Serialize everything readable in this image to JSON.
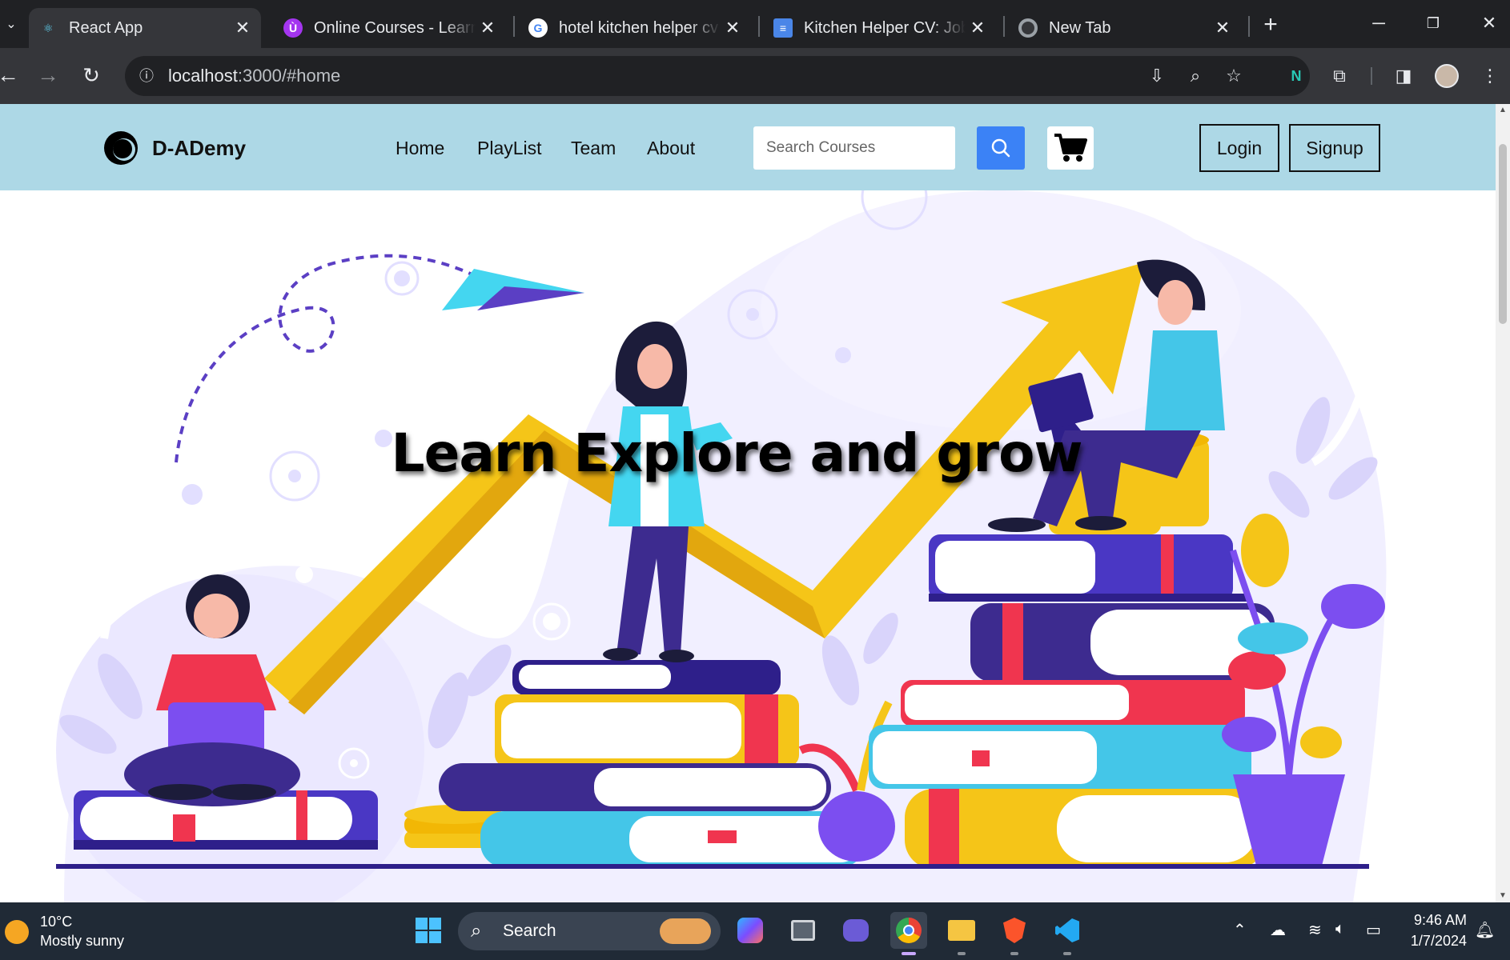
{
  "browser": {
    "tabs": [
      {
        "title": "React App",
        "icon": "react-icon",
        "active": true
      },
      {
        "title": "Online Courses - Learn Anything",
        "icon": "udemy-icon",
        "active": false
      },
      {
        "title": "hotel kitchen helper cv sample",
        "icon": "google-icon",
        "active": false
      },
      {
        "title": "Kitchen Helper CV: Job Description",
        "icon": "docs-icon",
        "active": false
      },
      {
        "title": "New Tab",
        "icon": "chrome-icon",
        "active": false
      }
    ],
    "url_host": "localhost",
    "url_path": ":3000/#home"
  },
  "site": {
    "brand": "D-ADemy",
    "nav": {
      "home": "Home",
      "playlist": "PlayList",
      "team": "Team",
      "about": "About"
    },
    "search_placeholder": "Search Courses",
    "login": "Login",
    "signup": "Signup",
    "hero_heading": "Learn Explore and grow"
  },
  "taskbar": {
    "weather_temp": "10°C",
    "weather_desc": "Mostly sunny",
    "search_label": "Search",
    "time": "9:46 AM",
    "date": "1/7/2024"
  },
  "colors": {
    "navbar_bg": "#add8e6",
    "search_button": "#3b82f6",
    "arrow_yellow": "#f5c518",
    "book_purple": "#3d2b8f",
    "book_red": "#f0354f",
    "book_cyan": "#44c6e8"
  }
}
